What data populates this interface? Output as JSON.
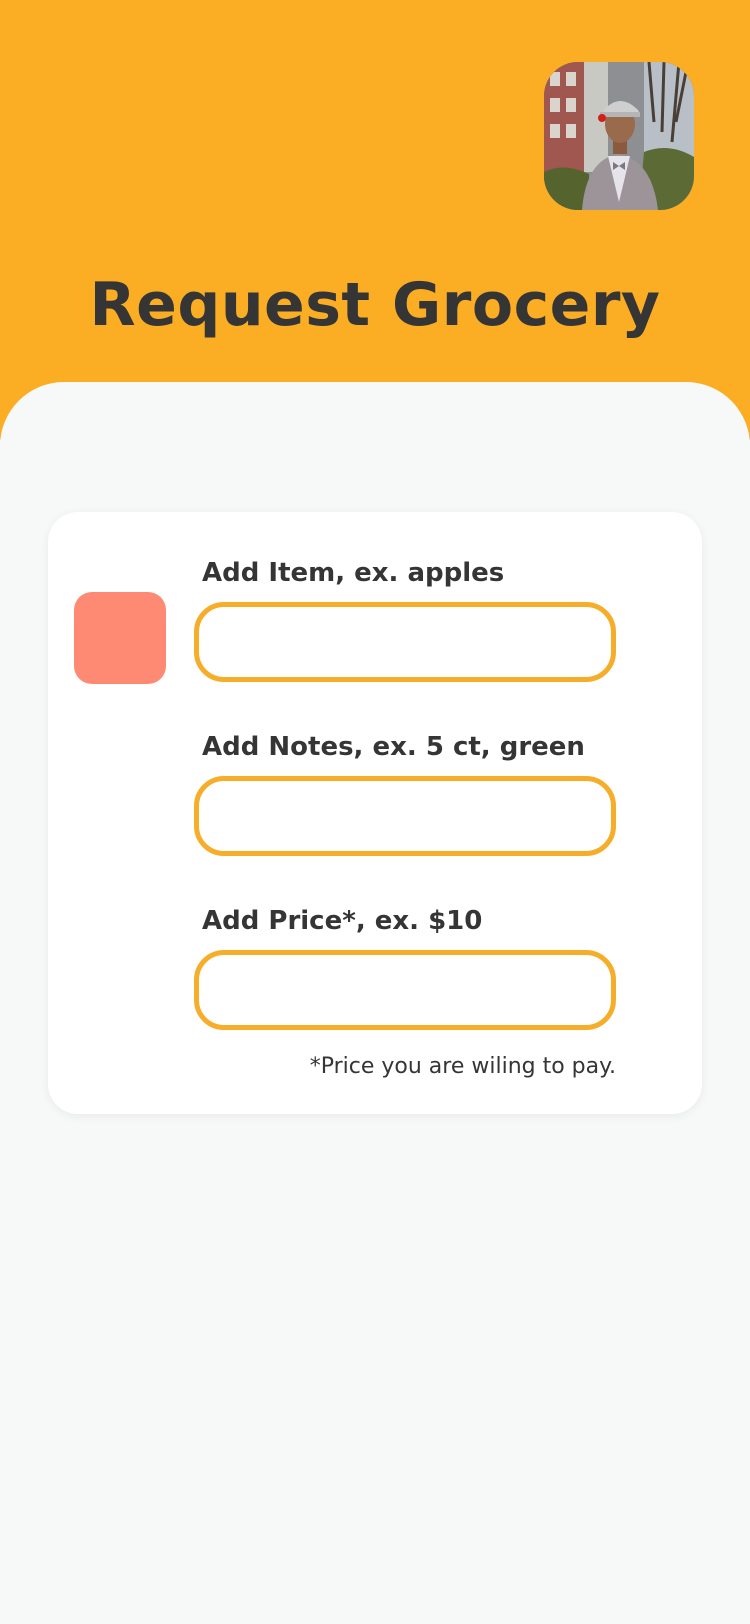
{
  "header": {
    "title": "Request Grocery",
    "avatar": "profile-photo"
  },
  "form": {
    "item": {
      "label": "Add Item, ex. apples",
      "value": "",
      "placeholder": ""
    },
    "notes": {
      "label": "Add Notes, ex. 5 ct, green",
      "value": "",
      "placeholder": ""
    },
    "price": {
      "label": "Add Price*, ex. $10",
      "value": "",
      "placeholder": ""
    },
    "footnote": "*Price you are wiling to pay."
  },
  "colors": {
    "header_bg": "#fbad24",
    "input_border": "#f5ad2a",
    "swatch": "#ff8a73",
    "text": "#353535",
    "background": "#f7f8f8"
  }
}
